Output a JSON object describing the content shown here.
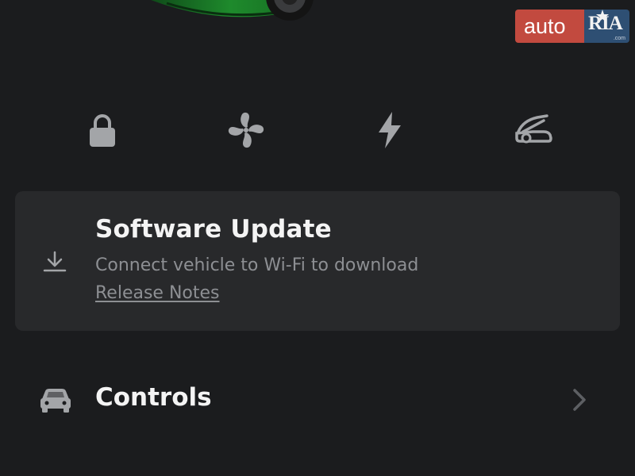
{
  "watermark": {
    "left_text": "auto",
    "right_text": "RIA",
    "right_domain": ".com"
  },
  "quick_controls": [
    {
      "icon": "lock-icon",
      "name": "lock"
    },
    {
      "icon": "fan-icon",
      "name": "climate"
    },
    {
      "icon": "lightning-bolt-icon",
      "name": "charge"
    },
    {
      "icon": "frunk-icon",
      "name": "frunk"
    }
  ],
  "software_update": {
    "title": "Software Update",
    "subtitle": "Connect vehicle to Wi-Fi to download",
    "link_label": "Release Notes",
    "icon": "download-icon"
  },
  "controls": {
    "label": "Controls",
    "icon": "car-icon",
    "chevron": "chevron-right-icon"
  },
  "colors": {
    "background": "#1b1c1e",
    "card": "#28292b",
    "icon_gray": "#a3a5a8",
    "secondary_text": "#8d8f93",
    "car_green": "#1e8a2c",
    "watermark_red": "#c24a3f",
    "watermark_blue": "#2e4f73"
  }
}
